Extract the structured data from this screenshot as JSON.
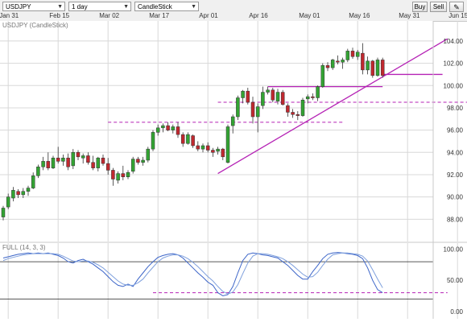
{
  "toolbar": {
    "symbol": "USDJPY",
    "interval": "1 day",
    "chart_style": "CandleStick",
    "buy_label": "Buy",
    "sell_label": "Sell"
  },
  "colors": {
    "up": "#33a333",
    "down": "#c0282f",
    "overlay": "#b522b5",
    "stoch_k": "#3b64c8",
    "stoch_d": "#7fa0dd",
    "grid": "#d8d8d8"
  },
  "chart_data": [
    {
      "type": "candlestick",
      "title": "USDJPY (CandleStick)",
      "x_tick_labels": [
        "Jan 31",
        "Feb 15",
        "Mar 02",
        "Mar 17",
        "Apr 01",
        "Apr 16",
        "May 01",
        "May 16",
        "May 31",
        "Jun 15"
      ],
      "y_tick_labels": [
        "88.00",
        "90.00",
        "92.00",
        "94.00",
        "96.00",
        "98.00",
        "100.00",
        "102.00",
        "104.00"
      ],
      "ylim": [
        86,
        105.8
      ],
      "grid": true,
      "candles": [
        [
          88.2,
          89.2,
          87.9,
          89.0
        ],
        [
          89.1,
          90.3,
          88.9,
          90.0
        ],
        [
          89.9,
          90.9,
          89.6,
          90.6
        ],
        [
          90.5,
          90.7,
          89.9,
          90.2
        ],
        [
          90.2,
          90.8,
          89.9,
          90.5
        ],
        [
          90.5,
          91.0,
          90.1,
          90.8
        ],
        [
          90.8,
          92.2,
          90.7,
          91.9
        ],
        [
          91.9,
          92.9,
          91.7,
          92.7
        ],
        [
          92.7,
          93.6,
          92.4,
          93.2
        ],
        [
          93.2,
          94.0,
          92.4,
          92.6
        ],
        [
          92.6,
          93.7,
          92.5,
          93.5
        ],
        [
          93.5,
          94.5,
          93.0,
          93.2
        ],
        [
          93.2,
          93.8,
          92.8,
          93.5
        ],
        [
          93.5,
          93.9,
          92.4,
          92.7
        ],
        [
          92.8,
          94.3,
          92.5,
          94.0
        ],
        [
          94.0,
          94.2,
          93.3,
          93.6
        ],
        [
          93.5,
          93.9,
          93.0,
          93.7
        ],
        [
          93.7,
          94.0,
          92.9,
          93.1
        ],
        [
          93.1,
          93.7,
          92.4,
          92.6
        ],
        [
          92.6,
          93.6,
          92.3,
          93.5
        ],
        [
          93.5,
          93.8,
          92.8,
          93.0
        ],
        [
          93.0,
          93.5,
          92.0,
          92.4
        ],
        [
          92.4,
          92.6,
          91.0,
          91.6
        ],
        [
          91.5,
          92.3,
          91.2,
          92.1
        ],
        [
          92.1,
          92.8,
          91.5,
          91.8
        ],
        [
          91.8,
          92.4,
          91.6,
          92.2
        ],
        [
          92.3,
          93.6,
          92.1,
          93.4
        ],
        [
          93.4,
          93.6,
          92.9,
          93.1
        ],
        [
          93.1,
          93.6,
          92.8,
          93.3
        ],
        [
          93.3,
          94.5,
          93.1,
          94.3
        ],
        [
          94.3,
          96.0,
          94.1,
          95.8
        ],
        [
          95.8,
          96.5,
          95.5,
          96.2
        ],
        [
          96.2,
          96.6,
          95.8,
          96.4
        ],
        [
          96.4,
          96.7,
          95.9,
          96.0
        ],
        [
          96.0,
          96.5,
          95.7,
          96.3
        ],
        [
          96.3,
          96.7,
          95.3,
          95.6
        ],
        [
          95.6,
          95.8,
          94.5,
          94.8
        ],
        [
          94.8,
          95.8,
          94.7,
          95.6
        ],
        [
          95.5,
          95.6,
          94.4,
          94.6
        ],
        [
          94.6,
          95.0,
          94.1,
          94.3
        ],
        [
          94.3,
          94.8,
          94.0,
          94.6
        ],
        [
          94.6,
          94.9,
          94.0,
          94.2
        ],
        [
          94.2,
          94.4,
          93.6,
          94.0
        ],
        [
          94.1,
          94.5,
          93.8,
          94.3
        ],
        [
          94.3,
          94.4,
          93.3,
          93.6
        ],
        [
          93.1,
          96.5,
          93.0,
          96.3
        ],
        [
          96.4,
          97.4,
          95.7,
          97.2
        ],
        [
          97.2,
          99.1,
          96.9,
          98.9
        ],
        [
          98.9,
          99.6,
          98.4,
          99.5
        ],
        [
          99.5,
          99.8,
          98.3,
          98.5
        ],
        [
          98.5,
          99.0,
          96.6,
          97.2
        ],
        [
          97.2,
          98.4,
          95.8,
          98.1
        ],
        [
          98.2,
          99.9,
          97.9,
          99.4
        ],
        [
          99.4,
          99.9,
          99.2,
          99.6
        ],
        [
          99.6,
          99.8,
          98.5,
          98.7
        ],
        [
          98.6,
          99.7,
          98.3,
          99.4
        ],
        [
          99.4,
          99.6,
          98.2,
          98.3
        ],
        [
          98.2,
          98.4,
          97.2,
          97.6
        ],
        [
          97.6,
          97.9,
          97.1,
          97.4
        ],
        [
          97.4,
          97.7,
          96.9,
          97.3
        ],
        [
          97.3,
          98.9,
          97.2,
          98.7
        ],
        [
          98.8,
          99.2,
          98.4,
          99.0
        ],
        [
          99.0,
          99.3,
          98.7,
          98.9
        ],
        [
          98.9,
          100.0,
          98.6,
          99.9
        ],
        [
          99.9,
          102.0,
          99.8,
          101.8
        ],
        [
          101.8,
          102.1,
          101.3,
          101.6
        ],
        [
          101.6,
          102.4,
          101.4,
          102.3
        ],
        [
          102.2,
          102.7,
          101.9,
          102.1
        ],
        [
          102.1,
          102.5,
          101.5,
          102.3
        ],
        [
          102.3,
          103.3,
          102.1,
          103.1
        ],
        [
          103.1,
          103.4,
          102.4,
          102.6
        ],
        [
          102.6,
          103.2,
          102.3,
          103.0
        ],
        [
          102.9,
          103.8,
          101.0,
          101.4
        ],
        [
          101.4,
          102.6,
          101.0,
          102.2
        ],
        [
          102.2,
          102.3,
          100.7,
          100.9
        ],
        [
          100.9,
          102.5,
          100.8,
          102.3
        ],
        [
          102.3,
          102.5,
          100.7,
          100.9
        ]
      ],
      "overlays": {
        "trendlines": [
          {
            "from": [
              43,
              92.1
            ],
            "to": [
              89,
              104.2
            ]
          },
          {
            "from": [
              53,
              99.9
            ],
            "to": [
              76,
              99.9
            ]
          },
          {
            "from": [
              76,
              101.0
            ],
            "to": [
              88,
              101.0
            ]
          }
        ],
        "dashed_levels": [
          {
            "value": 96.7,
            "from": 21,
            "to": 68
          },
          {
            "value": 98.5,
            "from": 43,
            "to": 96
          }
        ]
      }
    },
    {
      "type": "line",
      "title": "FULL (14, 3, 3)",
      "y_tick_labels": [
        "0.00",
        "50.00",
        "100.00"
      ],
      "ylim": [
        -12,
        110
      ],
      "reference_lines": [
        80,
        20
      ],
      "dashed_level": {
        "value": 30,
        "from": 30,
        "to": 89
      },
      "series": [
        {
          "values": [
            86,
            88,
            90,
            92,
            93,
            94,
            93,
            94,
            93,
            94,
            92,
            90,
            86,
            80,
            78,
            82,
            84,
            80,
            76,
            70,
            64,
            56,
            48,
            42,
            40,
            44,
            40,
            52,
            62,
            72,
            80,
            87,
            90,
            92,
            93,
            91,
            86,
            78,
            70,
            62,
            55,
            47,
            42,
            30,
            25,
            27,
            40,
            62,
            82,
            92,
            94,
            93,
            91,
            90,
            88,
            86,
            80,
            74,
            66,
            58,
            52,
            52,
            64,
            74,
            85,
            92,
            94,
            95,
            94,
            93,
            92,
            90,
            85,
            70,
            50,
            35,
            30
          ]
        },
        {
          "values": [
            82,
            85,
            87,
            89,
            91,
            92,
            93,
            93,
            93,
            93,
            93,
            92,
            89,
            85,
            81,
            80,
            81,
            81,
            79,
            75,
            70,
            63,
            56,
            49,
            44,
            42,
            42,
            46,
            52,
            62,
            71,
            80,
            86,
            89,
            91,
            91,
            89,
            85,
            79,
            72,
            64,
            56,
            49,
            40,
            32,
            28,
            31,
            43,
            61,
            78,
            89,
            93,
            93,
            92,
            90,
            88,
            85,
            80,
            74,
            67,
            60,
            55,
            56,
            63,
            74,
            84,
            91,
            93,
            94,
            94,
            93,
            92,
            89,
            81,
            67,
            52,
            38
          ]
        }
      ]
    }
  ]
}
